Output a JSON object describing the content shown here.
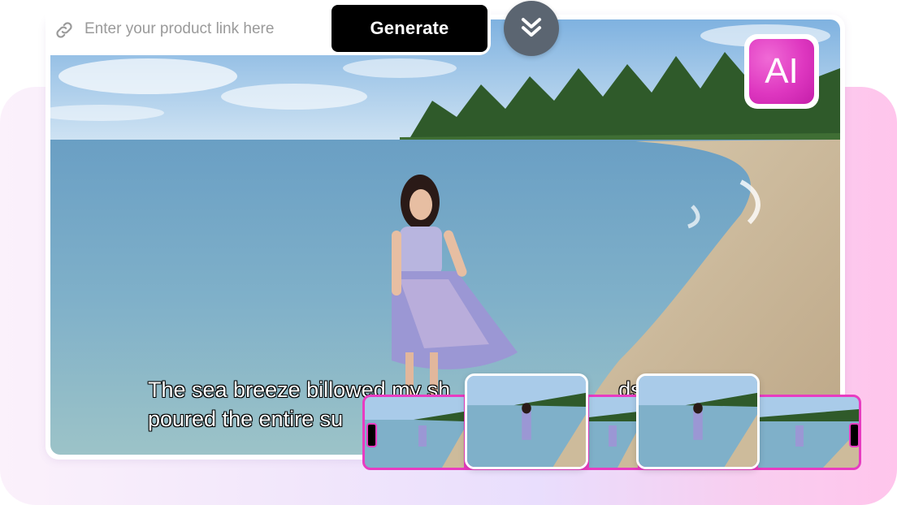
{
  "input": {
    "placeholder": "Enter your product link here"
  },
  "actions": {
    "generate_label": "Generate"
  },
  "badge": {
    "label": "AI"
  },
  "caption": {
    "line1": "The sea breeze billowed my sh",
    "line1_end": "ds, a",
    "line2": "poured the entire su"
  },
  "icons": {
    "link": "link-icon",
    "expand": "chevrons-down-icon"
  },
  "colors": {
    "accent": "#e83cc1",
    "button": "#000000",
    "chevron_bg": "#5b6571"
  }
}
